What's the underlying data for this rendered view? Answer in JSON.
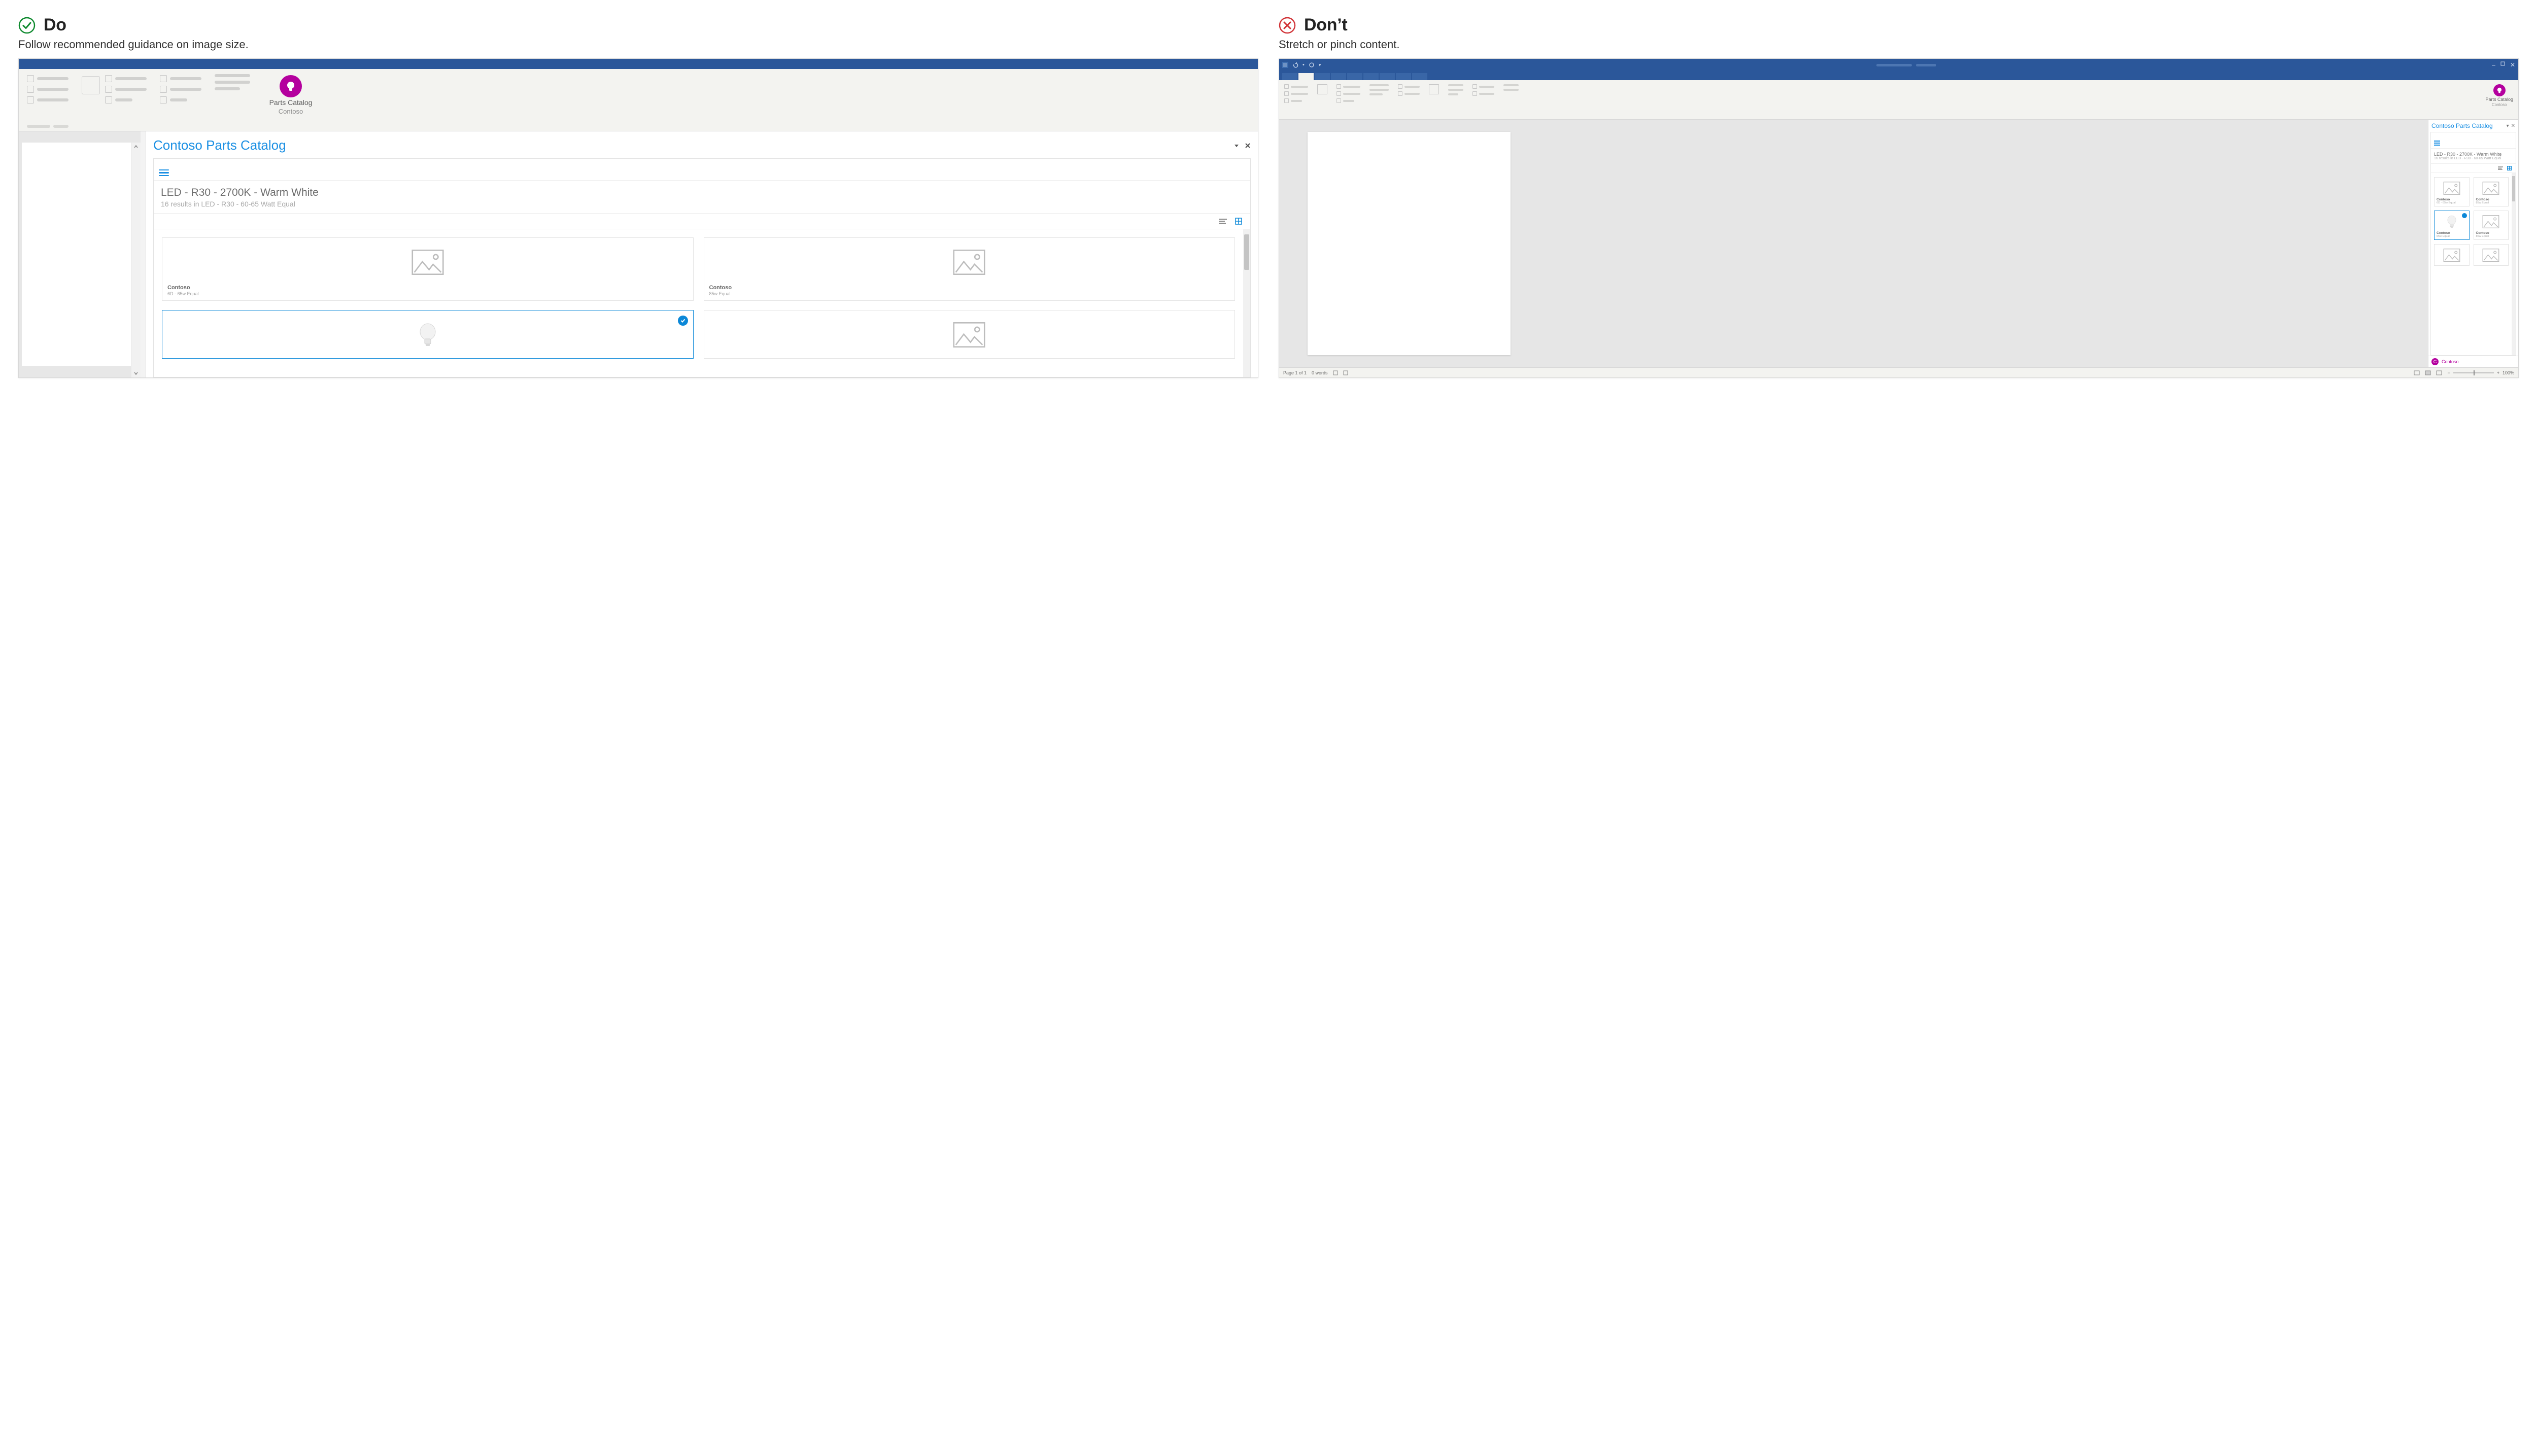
{
  "do": {
    "heading": "Do",
    "subhead": "Follow recommended guidance on image size.",
    "addin": {
      "line1": "Parts Catalog",
      "line2": "Contoso"
    },
    "pane": {
      "title": "Contoso Parts Catalog",
      "breadcrumb_main": "LED - R30 - 2700K - Warm White",
      "breadcrumb_sub": "16 results in LED - R30 - 60-65 Watt Equal",
      "cards": [
        {
          "brand": "Contoso",
          "sub": "6D - 65w Equal",
          "selected": false,
          "thumb": "placeholder"
        },
        {
          "brand": "Contoso",
          "sub": "85w Equal",
          "selected": false,
          "thumb": "placeholder"
        },
        {
          "brand": "",
          "sub": "",
          "selected": true,
          "thumb": "bulb"
        },
        {
          "brand": "",
          "sub": "",
          "selected": false,
          "thumb": "placeholder"
        }
      ]
    }
  },
  "dont": {
    "heading": "Don’t",
    "subhead": "Stretch or pinch content.",
    "addin": {
      "line1": "Parts Catalog",
      "line2": "Contoso"
    },
    "pane": {
      "title": "Contoso Parts Catalog",
      "breadcrumb_main": "LED - R30 - 2700K - Warm White",
      "breadcrumb_sub": "16 results in LED - R30 - 60-65 Watt Equal",
      "cards": [
        {
          "brand": "Contoso",
          "sub": "6D - 65w Equal",
          "selected": false,
          "thumb": "placeholder"
        },
        {
          "brand": "Contoso",
          "sub": "85w Equal",
          "selected": false,
          "thumb": "placeholder"
        },
        {
          "brand": "Contoso",
          "sub": "65w Equal",
          "selected": true,
          "thumb": "bulb"
        },
        {
          "brand": "Contoso",
          "sub": "85w Equal",
          "selected": false,
          "thumb": "placeholder"
        },
        {
          "brand": "",
          "sub": "",
          "selected": false,
          "thumb": "placeholder"
        },
        {
          "brand": "",
          "sub": "",
          "selected": false,
          "thumb": "placeholder"
        }
      ],
      "footer_name": "Contoso",
      "footer_initial": "C"
    },
    "statusbar": {
      "page": "Page 1 of 1",
      "words": "0 words",
      "zoom": "100%"
    }
  }
}
